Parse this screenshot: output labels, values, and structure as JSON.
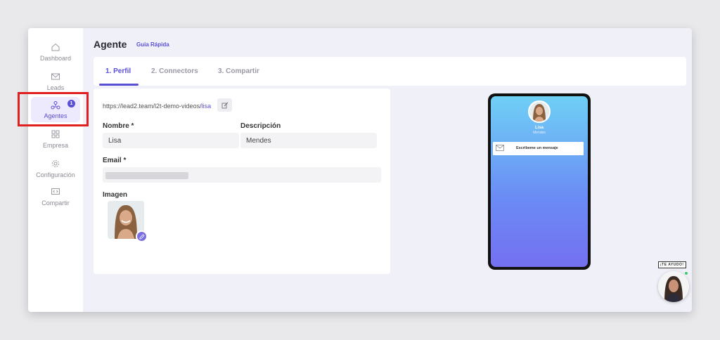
{
  "sidebar": {
    "items": [
      {
        "label": "Dashboard",
        "icon": "home-icon"
      },
      {
        "label": "Leads",
        "icon": "mail-icon"
      },
      {
        "label": "Agentes",
        "icon": "agents-icon",
        "active": true,
        "badge": "1"
      },
      {
        "label": "Empresa",
        "icon": "grid-icon"
      },
      {
        "label": "Configuración",
        "icon": "gear-icon"
      },
      {
        "label": "Compartir",
        "icon": "code-icon"
      }
    ]
  },
  "header": {
    "title": "Agente",
    "quick_guide": "Guia Rápida"
  },
  "tabs": [
    {
      "label": "1. Perfil",
      "active": true
    },
    {
      "label": "2. Connectors"
    },
    {
      "label": "3. Compartir"
    }
  ],
  "form": {
    "url_prefix": "https://lead2.team/l2t-demo-videos/",
    "url_slug": "lisa",
    "nombre_label": "Nombre *",
    "nombre_value": "Lisa",
    "descripcion_label": "Descripción",
    "descripcion_value": "Mendes",
    "email_label": "Email *",
    "imagen_label": "Imagen"
  },
  "preview": {
    "name": "Lisa",
    "subtitle": "Mendes",
    "message_button": "Escribeme un mensaje"
  },
  "help": {
    "tag": "¡TE AYUDO!"
  },
  "colors": {
    "accent": "#5b4fd6",
    "highlight": "#e02020",
    "online": "#37c96b"
  }
}
